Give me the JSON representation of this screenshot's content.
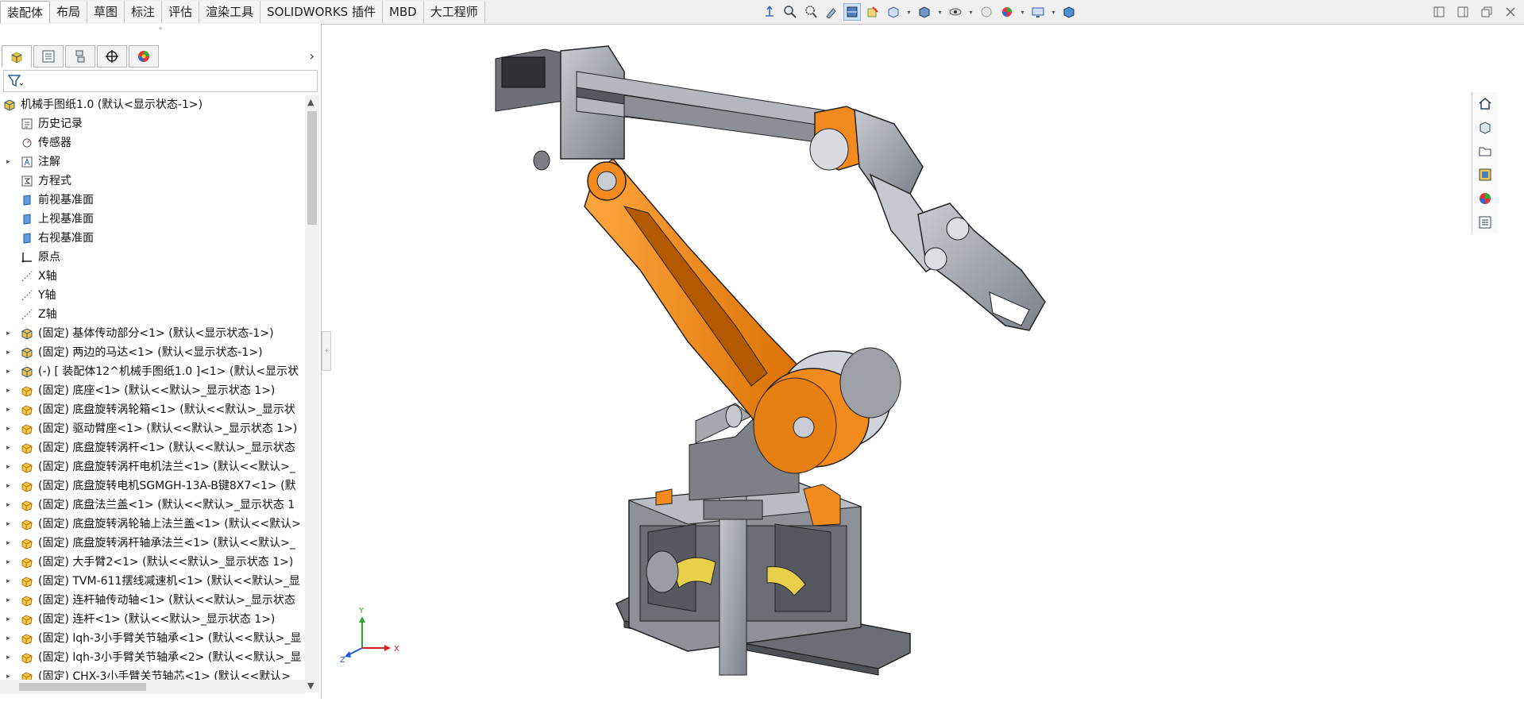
{
  "tabs": [
    "装配体",
    "布局",
    "草图",
    "标注",
    "评估",
    "渲染工具",
    "SOLIDWORKS 插件",
    "MBD",
    "大工程师"
  ],
  "active_tab": "装配体",
  "colors": {
    "accent_orange": "#f28a1e",
    "steel": "#8d9097",
    "selection_blue": "#cfe3f7",
    "folder_yellow": "#f5c23d"
  },
  "headsup_icons": [
    "view-orientation-icon",
    "zoom-to-fit-icon",
    "zoom-area-icon",
    "previous-view-icon",
    "section-view-icon",
    "dynamic-annotation-icon",
    "view-orientation-dropdown-icon",
    "display-style-icon",
    "hide-show-icon",
    "edit-appearance-icon",
    "apply-scene-icon",
    "view-settings-icon",
    "display-pane-icon"
  ],
  "window_controls": [
    "tile-left-icon",
    "tile-right-icon",
    "restore-icon",
    "close-icon"
  ],
  "fm_tabs": [
    "featuremanager-tab-icon",
    "propertymanager-tab-icon",
    "configurationmanager-tab-icon",
    "dimxpert-tab-icon",
    "display-manager-tab-icon"
  ],
  "filter_icon": "filter-icon",
  "tree": [
    {
      "label": "机械手图纸1.0  (默认<显示状态-1>)",
      "icon": "assembly",
      "indent": 0,
      "expander": false
    },
    {
      "label": "历史记录",
      "icon": "history",
      "indent": 1,
      "expander": false
    },
    {
      "label": "传感器",
      "icon": "sensor",
      "indent": 1,
      "expander": false
    },
    {
      "label": "注解",
      "icon": "annotation",
      "indent": 1,
      "expander": true
    },
    {
      "label": "方程式",
      "icon": "equation",
      "indent": 1,
      "expander": false
    },
    {
      "label": "前视基准面",
      "icon": "plane",
      "indent": 1,
      "expander": false
    },
    {
      "label": "上视基准面",
      "icon": "plane",
      "indent": 1,
      "expander": false
    },
    {
      "label": "右视基准面",
      "icon": "plane",
      "indent": 1,
      "expander": false
    },
    {
      "label": "原点",
      "icon": "origin",
      "indent": 1,
      "expander": false
    },
    {
      "label": "X轴",
      "icon": "axis",
      "indent": 1,
      "expander": false
    },
    {
      "label": "Y轴",
      "icon": "axis",
      "indent": 1,
      "expander": false
    },
    {
      "label": "Z轴",
      "icon": "axis",
      "indent": 1,
      "expander": false
    },
    {
      "label": "(固定) 基体传动部分<1> (默认<显示状态-1>)",
      "icon": "subassembly",
      "indent": 1,
      "expander": true
    },
    {
      "label": "(固定) 两边的马达<1> (默认<显示状态-1>)",
      "icon": "subassembly",
      "indent": 1,
      "expander": true
    },
    {
      "label": "(-) [ 装配体12^机械手图纸1.0 ]<1> (默认<显示状",
      "icon": "subassembly",
      "indent": 1,
      "expander": true
    },
    {
      "label": "(固定) 底座<1> (默认<<默认>_显示状态 1>)",
      "icon": "part",
      "indent": 1,
      "expander": true
    },
    {
      "label": "(固定) 底盘旋转涡轮箱<1> (默认<<默认>_显示状",
      "icon": "part",
      "indent": 1,
      "expander": true
    },
    {
      "label": "(固定) 驱动臂座<1> (默认<<默认>_显示状态 1>)",
      "icon": "part",
      "indent": 1,
      "expander": true
    },
    {
      "label": "(固定) 底盘旋转涡杆<1> (默认<<默认>_显示状态",
      "icon": "part",
      "indent": 1,
      "expander": true
    },
    {
      "label": "(固定) 底盘旋转涡杆电机法兰<1> (默认<<默认>_",
      "icon": "part",
      "indent": 1,
      "expander": true
    },
    {
      "label": "(固定) 底盘旋转电机SGMGH-13A-B键8X7<1> (默",
      "icon": "part",
      "indent": 1,
      "expander": true
    },
    {
      "label": "(固定) 底盘法兰盖<1> (默认<<默认>_显示状态 1",
      "icon": "part",
      "indent": 1,
      "expander": true
    },
    {
      "label": "(固定) 底盘旋转涡轮轴上法兰盖<1> (默认<<默认>",
      "icon": "part",
      "indent": 1,
      "expander": true
    },
    {
      "label": "(固定) 底盘旋转涡杆轴承法兰<1> (默认<<默认>_",
      "icon": "part",
      "indent": 1,
      "expander": true
    },
    {
      "label": "(固定) 大手臂2<1> (默认<<默认>_显示状态 1>)",
      "icon": "part",
      "indent": 1,
      "expander": true
    },
    {
      "label": "(固定) TVM-611摆线减速机<1> (默认<<默认>_显",
      "icon": "part",
      "indent": 1,
      "expander": true
    },
    {
      "label": "(固定) 连杆轴传动轴<1> (默认<<默认>_显示状态",
      "icon": "part",
      "indent": 1,
      "expander": true
    },
    {
      "label": "(固定) 连杆<1> (默认<<默认>_显示状态 1>)",
      "icon": "part",
      "indent": 1,
      "expander": true
    },
    {
      "label": "(固定) lqh-3小手臂关节轴承<1> (默认<<默认>_显",
      "icon": "part",
      "indent": 1,
      "expander": true
    },
    {
      "label": "(固定) lqh-3小手臂关节轴承<2> (默认<<默认>_显",
      "icon": "part",
      "indent": 1,
      "expander": true
    },
    {
      "label": "(固定) CHX-3小手臂关节轴芯<1> (默认<<默认>_",
      "icon": "part",
      "indent": 1,
      "expander": true
    }
  ],
  "triad": {
    "x": "X",
    "y": "Y",
    "z": "Z"
  },
  "task_pane": [
    "home-icon",
    "design-library-icon",
    "file-explorer-icon",
    "view-palette-icon",
    "appearances-icon",
    "custom-properties-icon"
  ]
}
